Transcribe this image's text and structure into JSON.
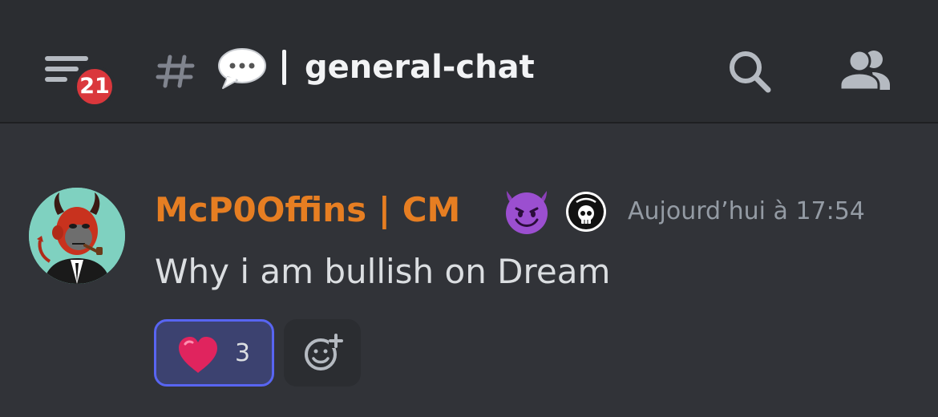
{
  "header": {
    "notification_count": "21",
    "channel_name": "general-chat",
    "icons": {
      "menu": "hamburger-menu-icon",
      "hash": "hash-icon",
      "channel_emoji": "speech-balloon-icon",
      "search": "search-icon",
      "members": "members-icon"
    }
  },
  "message": {
    "author": "McP0Offins | CM",
    "author_color": "#e67e22",
    "timestamp": "Aujourd’hui à 17:54",
    "content": "Why i am bullish on Dream",
    "badges": [
      "smiling-devil-emoji",
      "croots-skull-badge"
    ],
    "reactions": [
      {
        "emoji": "red-heart-emoji",
        "count": "3",
        "selected": true
      }
    ],
    "add_reaction_icon": "add-reaction-icon"
  },
  "colors": {
    "header_bg": "#2b2d31",
    "chat_bg": "#313338",
    "badge_red": "#da373c",
    "reaction_selected_border": "#5865f2",
    "timestamp_gray": "#949ba4"
  }
}
